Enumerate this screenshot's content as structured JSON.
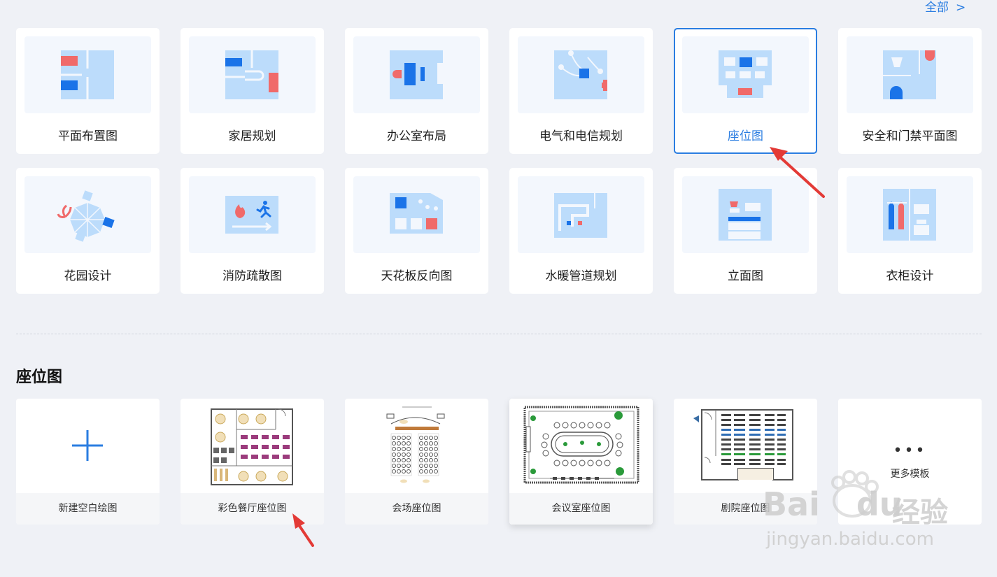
{
  "header": {
    "all_label": "全部",
    "chevron": ">"
  },
  "categories": [
    {
      "label": "平面布置图"
    },
    {
      "label": "家居规划"
    },
    {
      "label": "办公室布局"
    },
    {
      "label": "电气和电信规划"
    },
    {
      "label": "座位图",
      "selected": true
    },
    {
      "label": "安全和门禁平面图"
    },
    {
      "label": "花园设计"
    },
    {
      "label": "消防疏散图"
    },
    {
      "label": "天花板反向图"
    },
    {
      "label": "水暖管道规划"
    },
    {
      "label": "立面图"
    },
    {
      "label": "衣柜设计"
    }
  ],
  "section": {
    "title": "座位图"
  },
  "templates": [
    {
      "label": "新建空白绘图",
      "icon": "plus-icon"
    },
    {
      "label": "彩色餐厅座位图"
    },
    {
      "label": "会场座位图"
    },
    {
      "label": "会议室座位图"
    },
    {
      "label": "剧院座位图"
    },
    {
      "label": "更多模板",
      "icon": "ellipsis-icon"
    }
  ],
  "watermark": {
    "brand": "Bai",
    "brand2": "du",
    "cn": "经验",
    "url": "jingyan.baidu.com"
  },
  "colors": {
    "accent": "#2a7de1",
    "red_annotation": "#e33a36",
    "plan_fill": "#bcdcfb",
    "plan_blue": "#1a73e8",
    "plan_red": "#f06a6a"
  }
}
